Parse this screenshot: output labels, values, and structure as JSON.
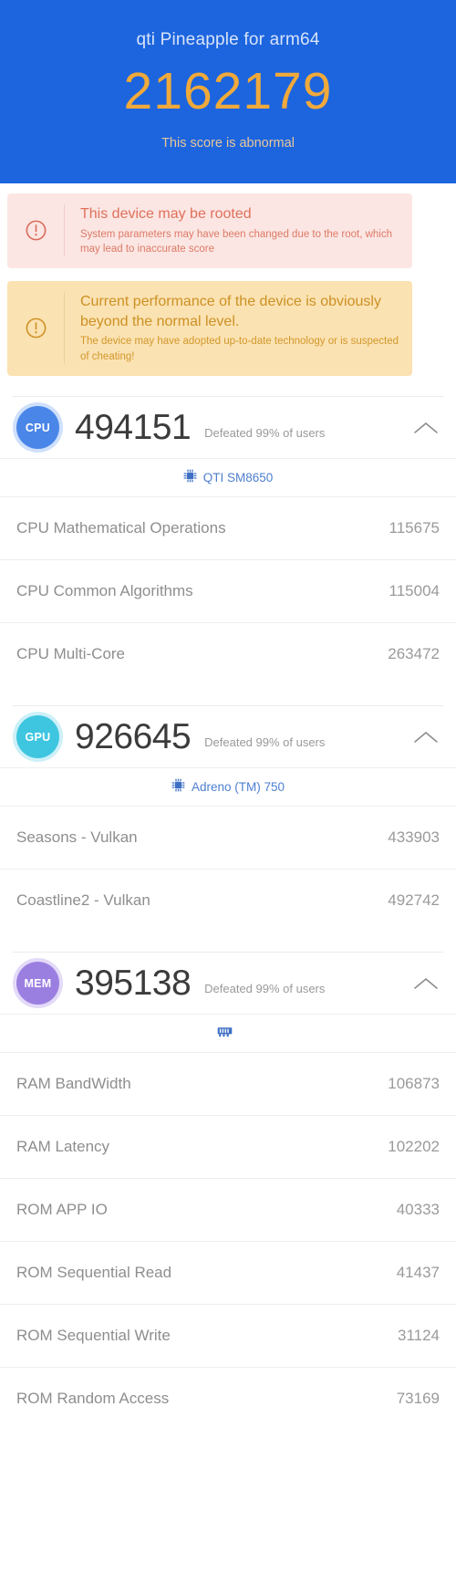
{
  "header": {
    "device_title": "qti Pineapple for arm64",
    "total_score": "2162179",
    "score_note": "This score is abnormal",
    "bg_color": "#1c65df",
    "score_color": "#f0a93a"
  },
  "warnings": [
    {
      "icon": "exclamation-circle-icon",
      "title": "This device may be rooted",
      "body": "System parameters may have been changed due to the root, which may lead to inaccurate score",
      "accent": "#e0705b",
      "background": "#fbe6e3"
    },
    {
      "icon": "exclamation-circle-icon",
      "title": "Current performance of the device is obviously beyond the normal level.",
      "body": "The device may have adopted up-to-date technology or is suspected of cheating!",
      "accent": "#cc9124",
      "background": "#fbe2b2"
    }
  ],
  "sections": [
    {
      "badge": "CPU",
      "badge_color": "#4a86e8",
      "score": "494151",
      "defeated": "Defeated 99% of users",
      "collapse_icon": "chevron-up-icon",
      "chip_icon": "cpu-chip-icon",
      "chip_name": "QTI SM8650",
      "rows": [
        {
          "label": "CPU Mathematical Operations",
          "value": "115675"
        },
        {
          "label": "CPU Common Algorithms",
          "value": "115004"
        },
        {
          "label": "CPU Multi-Core",
          "value": "263472"
        }
      ]
    },
    {
      "badge": "GPU",
      "badge_color": "#3ec6e0",
      "score": "926645",
      "defeated": "Defeated 99% of users",
      "collapse_icon": "chevron-up-icon",
      "chip_icon": "gpu-chip-icon",
      "chip_name": "Adreno (TM) 750",
      "rows": [
        {
          "label": "Seasons - Vulkan",
          "value": "433903"
        },
        {
          "label": "Coastline2 - Vulkan",
          "value": "492742"
        }
      ]
    },
    {
      "badge": "MEM",
      "badge_color": "#9b7fe0",
      "score": "395138",
      "defeated": "Defeated 99% of users",
      "collapse_icon": "chevron-up-icon",
      "chip_icon": "memory-chip-icon",
      "chip_name": "",
      "rows": [
        {
          "label": "RAM BandWidth",
          "value": "106873"
        },
        {
          "label": "RAM Latency",
          "value": "102202"
        },
        {
          "label": "ROM APP IO",
          "value": "40333"
        },
        {
          "label": "ROM Sequential Read",
          "value": "41437"
        },
        {
          "label": "ROM Sequential Write",
          "value": "31124"
        },
        {
          "label": "ROM Random Access",
          "value": "73169"
        }
      ]
    }
  ]
}
